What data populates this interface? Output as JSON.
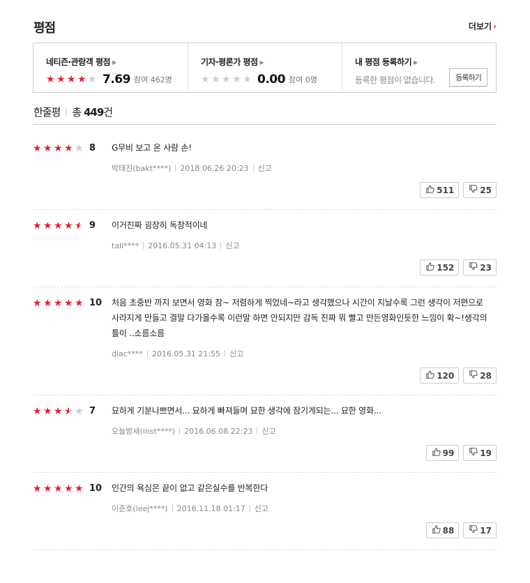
{
  "header": {
    "title": "평점",
    "more_label": "더보기"
  },
  "scores": {
    "netizen": {
      "label": "네티즌·관람객 평점",
      "score": "7.69",
      "count": "참여 462명",
      "stars": [
        1,
        1,
        1,
        1,
        0
      ]
    },
    "critic": {
      "label": "기자·평론가 평점",
      "score": "0.00",
      "count": "참여 0명",
      "stars": [
        0,
        0,
        0,
        0,
        0
      ]
    },
    "mine": {
      "label": "내 평점 등록하기",
      "empty_text": "등록한 평점이 없습니다.",
      "button_label": "등록하기"
    }
  },
  "review_header": {
    "label": "한줄평",
    "total_prefix": "총 ",
    "total_count": "449",
    "total_suffix": "건"
  },
  "reviews": [
    {
      "stars": [
        1,
        1,
        1,
        1,
        0
      ],
      "score": "8",
      "text": "G무비 보고 온 사람 손!",
      "author": "박태진(bakt****)",
      "date": "2018.06.26 20:23",
      "report": "신고",
      "likes": "511",
      "dislikes": "25"
    },
    {
      "stars": [
        1,
        1,
        1,
        1,
        0.5
      ],
      "score": "9",
      "text": "이거진짜 굉장히 독창적이네",
      "author": "tall****",
      "date": "2016.05.31 04:13",
      "report": "신고",
      "likes": "152",
      "dislikes": "23"
    },
    {
      "stars": [
        1,
        1,
        1,
        1,
        1
      ],
      "score": "10",
      "text": "처음 초중반 까지 보면서 영화 참~ 저렴하게 찍었네~라고 생각했으나 시간이 지날수록 그런 생각이 저편으로 사라지게 만들고 결말 다가올수록 이런말 하면 안되지만 감독 진짜 뭐 빨고 만든영화인듯한 느낌이 확~!생각의 틀이 ..소름소름",
      "author": "dlac****",
      "date": "2016.05.31 21:55",
      "report": "신고",
      "likes": "120",
      "dislikes": "28"
    },
    {
      "stars": [
        1,
        1,
        1,
        0.5,
        0
      ],
      "score": "7",
      "text": "묘하게 기분나쁘면서... 묘하게 빠져들며 묘한 생각에 잠기게되는... 묘한 영화...",
      "author": "오늘밤새(inst****)",
      "date": "2016.06.08 22:23",
      "report": "신고",
      "likes": "99",
      "dislikes": "19"
    },
    {
      "stars": [
        1,
        1,
        1,
        1,
        1
      ],
      "score": "10",
      "text": "인간의 욕심은 끝이 없고 같은실수를 반복한다",
      "author": "이준호(leej****)",
      "date": "2016.11.18 01:17",
      "report": "신고",
      "likes": "88",
      "dislikes": "17"
    }
  ],
  "icons": {
    "like": "thumbs-up-icon",
    "dislike": "thumbs-down-icon",
    "star": "star-icon"
  },
  "colors": {
    "accent": "#e51e30",
    "star_empty": "#cccccc"
  }
}
